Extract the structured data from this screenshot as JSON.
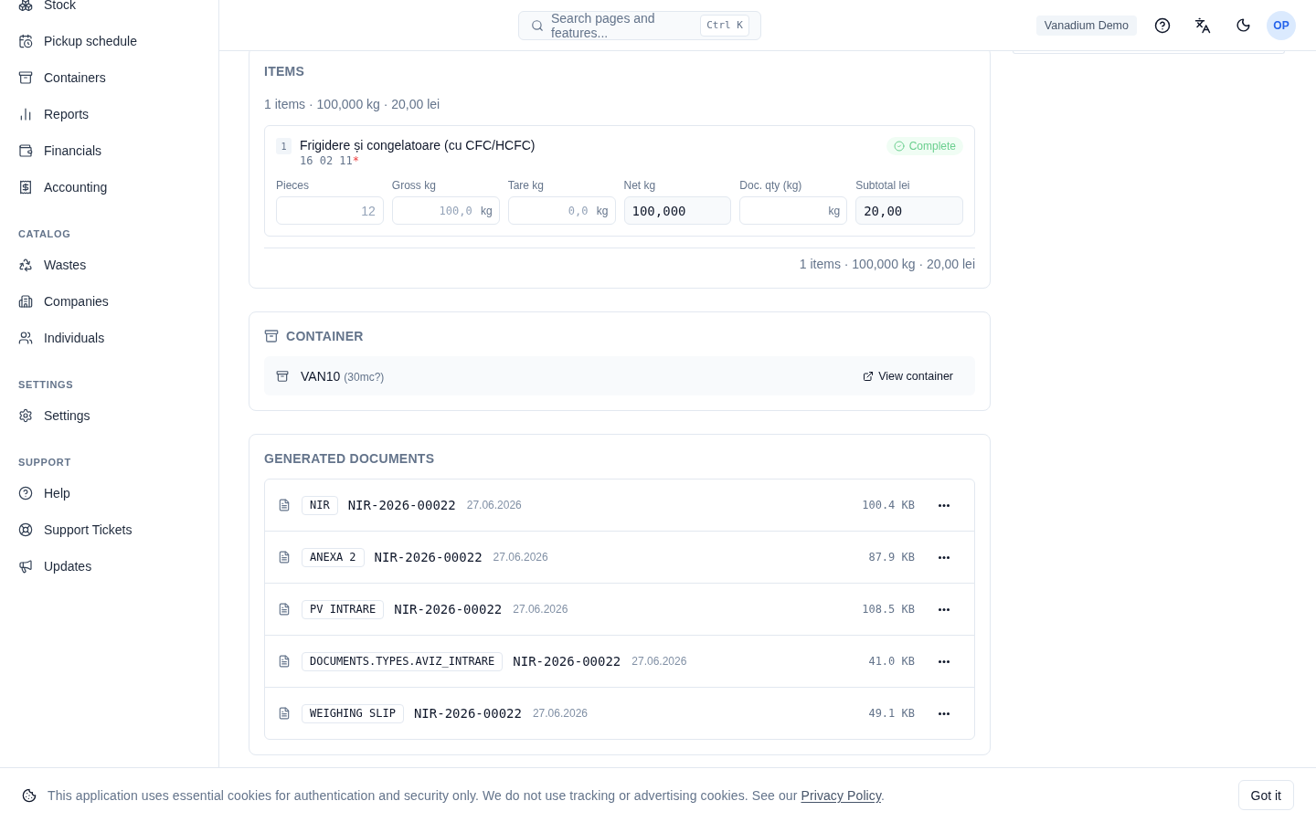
{
  "sidebar": {
    "groups": [
      {
        "items": [
          {
            "label": "Stock",
            "selected": false
          },
          {
            "label": "Pickup schedule",
            "selected": false
          },
          {
            "label": "Containers",
            "selected": false
          },
          {
            "label": "Reports",
            "selected": false
          },
          {
            "label": "Financials",
            "selected": false
          },
          {
            "label": "Accounting",
            "selected": false
          }
        ]
      },
      {
        "heading": "CATALOG",
        "items": [
          {
            "label": "Wastes",
            "selected": false
          },
          {
            "label": "Companies",
            "selected": false
          },
          {
            "label": "Individuals",
            "selected": false
          }
        ]
      },
      {
        "heading": "SETTINGS",
        "items": [
          {
            "label": "Settings",
            "selected": false
          }
        ]
      },
      {
        "heading": "SUPPORT",
        "items": [
          {
            "label": "Help",
            "selected": false
          },
          {
            "label": "Support Tickets",
            "selected": false
          },
          {
            "label": "Updates",
            "selected": false
          }
        ]
      }
    ]
  },
  "header": {
    "search": {
      "label": "Search pages and features...",
      "shortcut": "Ctrl K"
    },
    "workspace": "Vanadium Demo",
    "avatar": "OP"
  },
  "items": {
    "title": "ITEMS",
    "summary": "1 items · 100,000 kg · 20,00 lei",
    "rows": [
      {
        "index": "1",
        "name": "Frigidere și congelatoare (cu CFC/HCFC)",
        "code": "16 02 11",
        "code_mark": "*",
        "status": {
          "kind": "complete",
          "label": "Complete"
        },
        "fields": [
          {
            "label": "Pieces",
            "kind": "count",
            "placeholder": "12"
          },
          {
            "label": "Gross kg",
            "kind": "measure",
            "placeholder": "100,0",
            "suffix": "kg"
          },
          {
            "label": "Tare kg",
            "kind": "measure",
            "placeholder": "0,0",
            "suffix": "kg"
          },
          {
            "label": "Net kg",
            "kind": "computed",
            "value": "100,000"
          },
          {
            "label": "Doc. qty (kg)",
            "kind": "measure",
            "suffix": "kg"
          },
          {
            "label": "Subtotal lei",
            "kind": "computed",
            "value": "20,00"
          }
        ]
      }
    ],
    "total": "1 items · 100,000 kg · 20,00 lei"
  },
  "container": {
    "title": "CONTAINER",
    "name": "VAN10",
    "detail": "(30mc?)",
    "link": "View container"
  },
  "documents": {
    "title": "GENERATED DOCUMENTS",
    "rows": [
      {
        "type": "NIR",
        "number": "NIR-2026-00022",
        "date": "27.06.2026",
        "size": "100.4 KB"
      },
      {
        "type": "ANEXA 2",
        "number": "NIR-2026-00022",
        "date": "27.06.2026",
        "size": "87.9 KB"
      },
      {
        "type": "PV INTRARE",
        "number": "NIR-2026-00022",
        "date": "27.06.2026",
        "size": "108.5 KB"
      },
      {
        "type": "DOCUMENTS.TYPES.AVIZ_INTRARE",
        "number": "NIR-2026-00022",
        "date": "27.06.2026",
        "size": "41.0 KB"
      },
      {
        "type": "WEIGHING SLIP",
        "number": "NIR-2026-00022",
        "date": "27.06.2026",
        "size": "49.1 KB"
      }
    ]
  },
  "cookie_banner": {
    "text": "This application uses essential cookies for authentication and security only. We do not use tracking or advertising cookies. See our",
    "link": "Privacy Policy",
    "after": ".",
    "button": "Got it"
  }
}
